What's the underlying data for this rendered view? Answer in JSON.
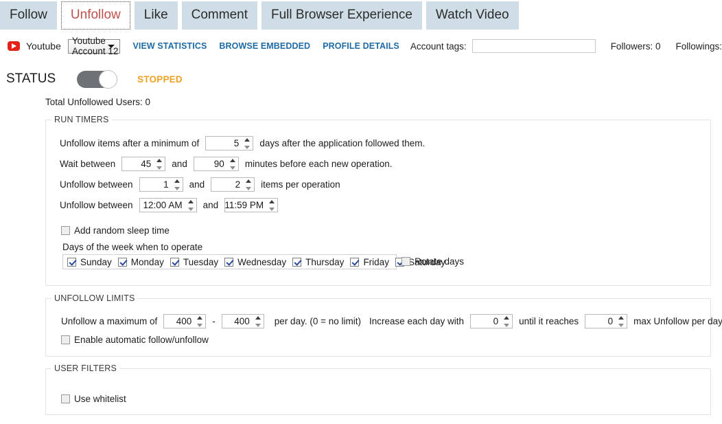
{
  "tabs": [
    {
      "label": "Follow",
      "selected": false
    },
    {
      "label": "Unfollow",
      "selected": true
    },
    {
      "label": "Like",
      "selected": false
    },
    {
      "label": "Comment",
      "selected": false
    },
    {
      "label": "Full Browser Experience",
      "selected": false
    },
    {
      "label": "Watch Video",
      "selected": false
    }
  ],
  "toolbar": {
    "platform_icon": "youtube-icon",
    "platform_label": "Youtube",
    "account_selected": "Youtube Account 12",
    "links": [
      "VIEW STATISTICS",
      "BROWSE EMBEDDED",
      "PROFILE DETAILS"
    ],
    "account_tags_label": "Account tags:",
    "account_tags_value": "",
    "account_tags_placeholder": "",
    "followers_text": "Followers: 0",
    "followings_text": "Followings:"
  },
  "status": {
    "label": "STATUS",
    "toggle_on": false,
    "state_text": "STOPPED",
    "state_color": "#eea020",
    "total_line": "Total Unfollowed Users: 0"
  },
  "run_timers": {
    "legend": "RUN TIMERS",
    "min_days": {
      "prefix": "Unfollow items after a minimum of",
      "value": "5",
      "suffix": "days after the application followed them."
    },
    "wait_between": {
      "prefix": "Wait between",
      "from": "45",
      "mid": "and",
      "to": "90",
      "suffix": "minutes before each new operation."
    },
    "items_between": {
      "prefix": "Unfollow between",
      "from": "1",
      "mid": "and",
      "to": "2",
      "suffix": "items per operation"
    },
    "time_between": {
      "prefix": "Unfollow between",
      "from": "12:00 AM",
      "mid": "and",
      "to": "11:59 PM"
    },
    "random_sleep": {
      "label": "Add random sleep time",
      "checked": false
    },
    "days_title": "Days of the week when to operate",
    "days": [
      {
        "label": "Sunday",
        "checked": true
      },
      {
        "label": "Monday",
        "checked": true
      },
      {
        "label": "Tuesday",
        "checked": true
      },
      {
        "label": "Wednesday",
        "checked": true
      },
      {
        "label": "Thursday",
        "checked": true
      },
      {
        "label": "Friday",
        "checked": true
      },
      {
        "label": "Saturday",
        "checked": true
      }
    ],
    "rotate_days": {
      "label": "Rotate days",
      "checked": false
    }
  },
  "unfollow_limits": {
    "legend": "UNFOLLOW LIMITS",
    "max_row": {
      "prefix": "Unfollow a maximum of",
      "from": "400",
      "dash": "-",
      "to": "400",
      "mid": "per day. (0 = no limit)",
      "increase_label": "Increase each day with",
      "increase_value": "0",
      "until_label": "until it reaches",
      "until_value": "0",
      "suffix": "max Unfollow per day."
    },
    "auto_follow": {
      "label": "Enable automatic follow/unfollow",
      "checked": false
    }
  },
  "user_filters": {
    "legend": "USER FILTERS",
    "use_whitelist": {
      "label": "Use whitelist",
      "checked": false
    }
  }
}
